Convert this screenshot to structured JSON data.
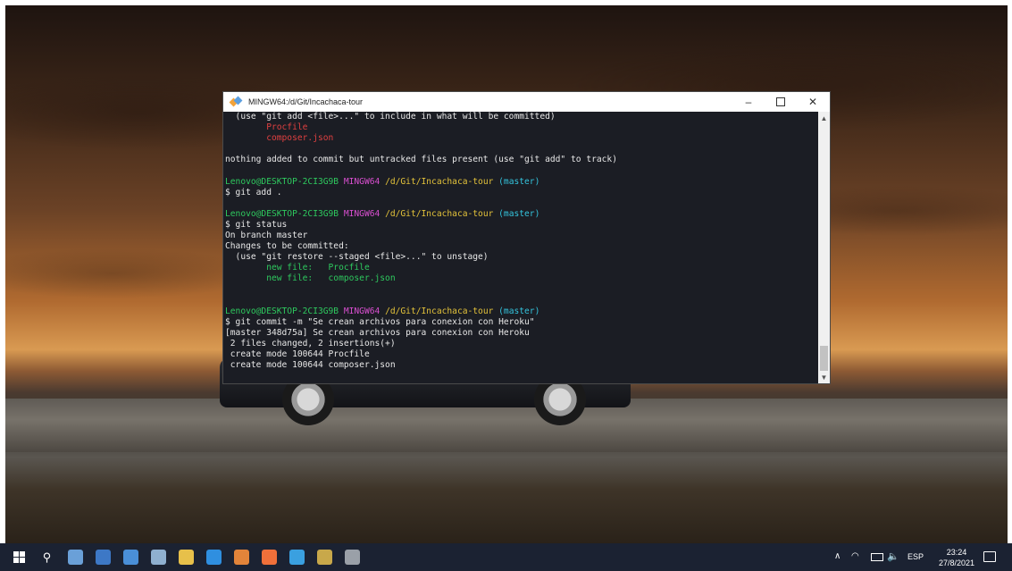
{
  "window": {
    "title": "MINGW64:/d/Git/Incachaca-tour",
    "minimize_label": "–",
    "close_label": "✕"
  },
  "terminal": {
    "lines": [
      [
        {
          "text": "  (use \"git add <file>...\" to include in what will be committed)",
          "color": "default"
        }
      ],
      [
        {
          "text": "        Procfile",
          "color": "red"
        }
      ],
      [
        {
          "text": "        composer.json",
          "color": "red"
        }
      ],
      [
        {
          "text": "",
          "color": "default"
        }
      ],
      [
        {
          "text": "nothing added to commit but untracked files present (use \"git add\" to track)",
          "color": "default"
        }
      ],
      [
        {
          "text": "",
          "color": "default"
        }
      ],
      [
        {
          "text": "Lenovo@DESKTOP-2CI3G9B ",
          "color": "green"
        },
        {
          "text": "MINGW64 ",
          "color": "magenta"
        },
        {
          "text": "/d/Git/Incachaca-tour ",
          "color": "yellow"
        },
        {
          "text": "(master)",
          "color": "cyan"
        }
      ],
      [
        {
          "text": "$ git add .",
          "color": "default"
        }
      ],
      [
        {
          "text": "",
          "color": "default"
        }
      ],
      [
        {
          "text": "Lenovo@DESKTOP-2CI3G9B ",
          "color": "green"
        },
        {
          "text": "MINGW64 ",
          "color": "magenta"
        },
        {
          "text": "/d/Git/Incachaca-tour ",
          "color": "yellow"
        },
        {
          "text": "(master)",
          "color": "cyan"
        }
      ],
      [
        {
          "text": "$ git status",
          "color": "default"
        }
      ],
      [
        {
          "text": "On branch master",
          "color": "default"
        }
      ],
      [
        {
          "text": "Changes to be committed:",
          "color": "default"
        }
      ],
      [
        {
          "text": "  (use \"git restore --staged <file>...\" to unstage)",
          "color": "default"
        }
      ],
      [
        {
          "text": "        new file:   Procfile",
          "color": "green"
        }
      ],
      [
        {
          "text": "        new file:   composer.json",
          "color": "green"
        }
      ],
      [
        {
          "text": "",
          "color": "default"
        }
      ],
      [
        {
          "text": "",
          "color": "default"
        }
      ],
      [
        {
          "text": "Lenovo@DESKTOP-2CI3G9B ",
          "color": "green"
        },
        {
          "text": "MINGW64 ",
          "color": "magenta"
        },
        {
          "text": "/d/Git/Incachaca-tour ",
          "color": "yellow"
        },
        {
          "text": "(master)",
          "color": "cyan"
        }
      ],
      [
        {
          "text": "$ git commit -m \"Se crean archivos para conexion con Heroku\"",
          "color": "default"
        }
      ],
      [
        {
          "text": "[master 348d75a] Se crean archivos para conexion con Heroku",
          "color": "default"
        }
      ],
      [
        {
          "text": " 2 files changed, 2 insertions(+)",
          "color": "default"
        }
      ],
      [
        {
          "text": " create mode 100644 Procfile",
          "color": "default"
        }
      ],
      [
        {
          "text": " create mode 100644 composer.json",
          "color": "default"
        }
      ]
    ]
  },
  "taskbar": {
    "apps": [
      {
        "name": "browser-app-icon",
        "color": "#6aa0d8"
      },
      {
        "name": "save-app-icon",
        "color": "#3d78c6"
      },
      {
        "name": "media-app-icon",
        "color": "#4a8fd8"
      },
      {
        "name": "database-app-icon",
        "color": "#8fb0d0"
      },
      {
        "name": "folder-app-icon",
        "color": "#e7c04a"
      },
      {
        "name": "vscode-app-icon",
        "color": "#2f8fe0"
      },
      {
        "name": "git-app-icon",
        "color": "#e2843a"
      },
      {
        "name": "firefox-app-icon",
        "color": "#f0703a"
      },
      {
        "name": "notes-app-icon",
        "color": "#3aa0e0"
      },
      {
        "name": "calendar-app-icon",
        "color": "#c8a84a"
      },
      {
        "name": "tool-app-icon",
        "color": "#9aa0a8"
      }
    ],
    "language": "ESP",
    "time": "23:24",
    "date": "27/8/2021"
  },
  "colors": {
    "default": "#e8e8e8",
    "green": "#2ec95e",
    "magenta": "#d94fd0",
    "yellow": "#e3c23a",
    "cyan": "#34c4dd",
    "red": "#e04040"
  }
}
